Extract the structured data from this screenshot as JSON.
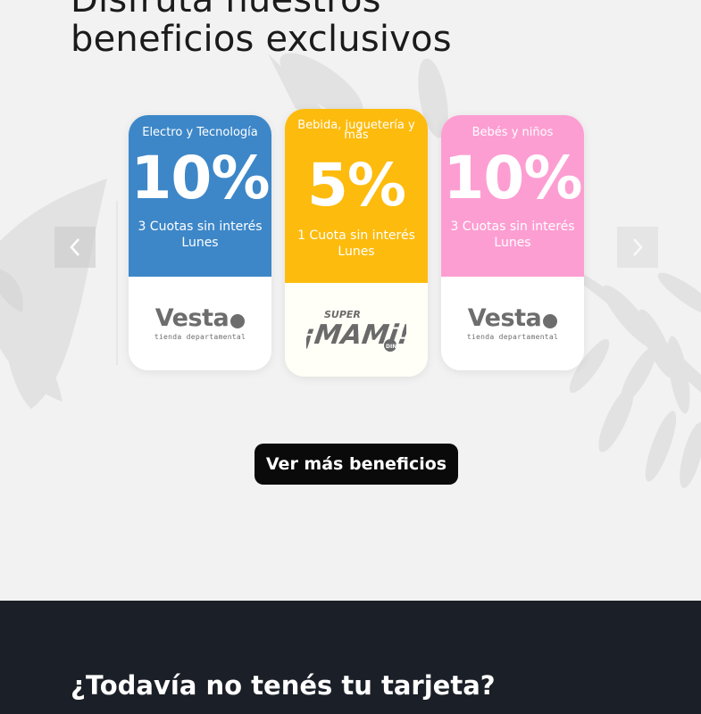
{
  "hero": {
    "title_line1": "Disfrutá nuestros",
    "title_line2": "beneficios exclusivos"
  },
  "carousel": {
    "prev_icon": "chevron-left-icon",
    "next_icon": "chevron-right-icon",
    "cards": [
      {
        "category": "Electro y Tecnología",
        "discount": "10%",
        "terms": "3 Cuotas sin interés Lunes",
        "store": "Vesta",
        "store_tagline": "tienda departamental",
        "color": "#3d87c8"
      },
      {
        "category": "Bebida, juguetería y más",
        "discount": "5%",
        "terms": "1 Cuota sin interés Lunes",
        "store": "SUPER ¡MAMi! DINO",
        "color": "#fdbb0d"
      },
      {
        "category": "Bebés y niños",
        "discount": "10%",
        "terms": "3 Cuotas sin interés Lunes",
        "store": "Vesta",
        "store_tagline": "tienda departamental",
        "color": "#fd9ed2"
      }
    ]
  },
  "cta": {
    "label": "Ver más beneficios"
  },
  "footer_section": {
    "title": "¿Todavía no tenés tu tarjeta?",
    "background": "#1b1f27"
  },
  "colors": {
    "page_background": "#f2f2f2",
    "button_background": "#0a0a0a",
    "logo_gray": "#6d6d6d"
  }
}
